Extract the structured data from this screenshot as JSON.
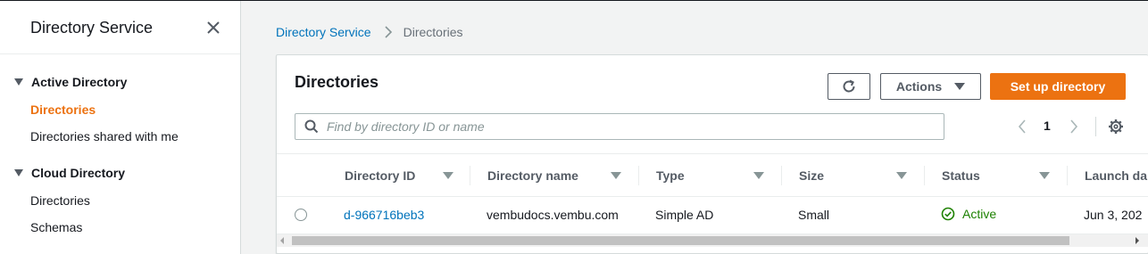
{
  "sidebar": {
    "title": "Directory Service",
    "sections": [
      {
        "label": "Active Directory",
        "items": [
          {
            "label": "Directories",
            "active": true
          },
          {
            "label": "Directories shared with me",
            "active": false
          }
        ]
      },
      {
        "label": "Cloud Directory",
        "items": [
          {
            "label": "Directories",
            "active": false
          },
          {
            "label": "Schemas",
            "active": false
          }
        ]
      }
    ]
  },
  "breadcrumb": {
    "root": "Directory Service",
    "current": "Directories"
  },
  "panel": {
    "title": "Directories",
    "actions_label": "Actions",
    "primary_label": "Set up directory",
    "search_placeholder": "Find by directory ID or name",
    "page": "1"
  },
  "table": {
    "columns": [
      "Directory ID",
      "Directory name",
      "Type",
      "Size",
      "Status",
      "Launch da"
    ],
    "rows": [
      {
        "directory_id": "d-966716beb3",
        "directory_name": "vembudocs.vembu.com",
        "type": "Simple AD",
        "size": "Small",
        "status": "Active",
        "launch_date": "Jun 3, 202"
      }
    ]
  },
  "colors": {
    "accent": "#ec7211",
    "link": "#0073bb",
    "status_active": "#1d8102"
  },
  "icons": [
    "close-icon",
    "chevron-right-icon",
    "refresh-icon",
    "caret-down-icon",
    "search-icon",
    "chevron-left-icon",
    "gear-icon",
    "check-circle-icon"
  ]
}
